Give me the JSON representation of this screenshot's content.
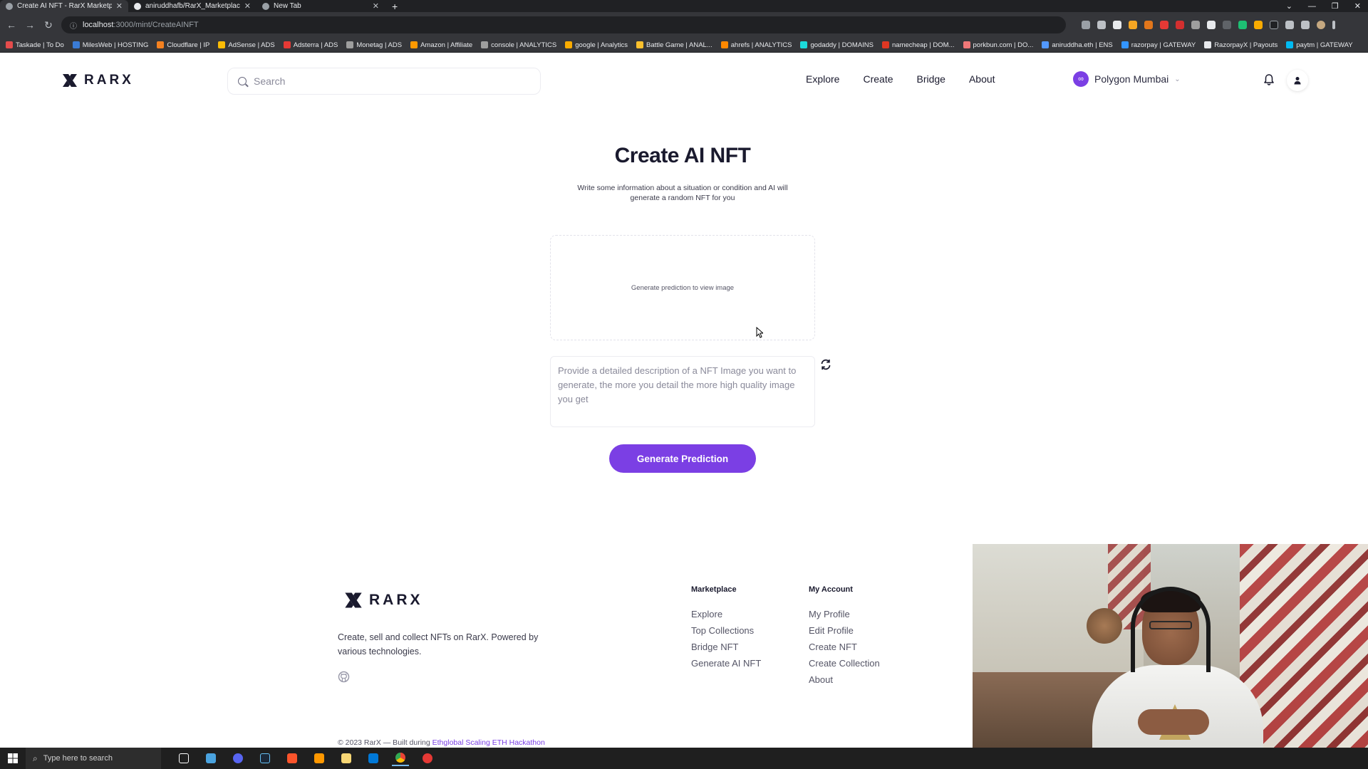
{
  "browser": {
    "tabs": [
      {
        "title": "Create AI NFT - RarX Marketplace",
        "active": true
      },
      {
        "title": "aniruddhafb/RarX_Marketplace:",
        "active": false
      },
      {
        "title": "New Tab",
        "active": false
      }
    ],
    "new_tab": "+",
    "url_host": "localhost",
    "url_path": ":3000/mint/CreateAINFT",
    "bookmarks": [
      {
        "label": "Taskade | To Do",
        "color": "#e44c4c"
      },
      {
        "label": "MilesWeb | HOSTING",
        "color": "#3a7bd5"
      },
      {
        "label": "Cloudflare | IP",
        "color": "#f48120"
      },
      {
        "label": "AdSense | ADS",
        "color": "#fbbc05"
      },
      {
        "label": "Adsterra | ADS",
        "color": "#e53935"
      },
      {
        "label": "Monetag | ADS",
        "color": "#9e9e9e"
      },
      {
        "label": "Amazon | Affiliate",
        "color": "#ff9900"
      },
      {
        "label": "console | ANALYTICS",
        "color": "#9e9e9e"
      },
      {
        "label": "google | Analytics",
        "color": "#f9ab00"
      },
      {
        "label": "Battle Game | ANAL...",
        "color": "#fbc02d"
      },
      {
        "label": "ahrefs | ANALYTICS",
        "color": "#ff8800"
      },
      {
        "label": "godaddy | DOMAINS",
        "color": "#1bdbdb"
      },
      {
        "label": "namecheap | DOM...",
        "color": "#de3723"
      },
      {
        "label": "porkbun.com | DO...",
        "color": "#ef7878"
      },
      {
        "label": "aniruddha.eth | ENS",
        "color": "#5298ff"
      },
      {
        "label": "razorpay | GATEWAY",
        "color": "#3395ff"
      },
      {
        "label": "RazorpayX | Payouts",
        "color": "#e8eaed"
      },
      {
        "label": "paytm | GATEWAY",
        "color": "#00baf2"
      }
    ]
  },
  "header": {
    "logo": "RARX",
    "search_placeholder": "Search",
    "nav": [
      "Explore",
      "Create",
      "Bridge",
      "About"
    ],
    "network": "Polygon Mumbai"
  },
  "main": {
    "title": "Create AI NFT",
    "subtitle": "Write some information about a situation or condition and AI will generate a random NFT for you",
    "preview_text": "Generate prediction to view image",
    "prompt_placeholder": "Provide a detailed description of a NFT Image you want to generate, the more you detail the more high quality image you get",
    "generate_button": "Generate Prediction"
  },
  "footer": {
    "logo": "RARX",
    "tagline": "Create, sell and collect NFTs on RarX. Powered by various technologies.",
    "marketplace": {
      "title": "Marketplace",
      "links": [
        "Explore",
        "Top Collections",
        "Bridge NFT",
        "Generate AI NFT"
      ]
    },
    "account": {
      "title": "My Account",
      "links": [
        "My Profile",
        "Edit Profile",
        "Create NFT",
        "Create Collection",
        "About"
      ]
    },
    "copyright_prefix": "© 2023 RarX — Built during",
    "copyright_link": "Ethglobal Scaling ETH Hackathon"
  },
  "taskbar": {
    "search_text": "Type here to search"
  },
  "colors": {
    "accent": "#7b3fe4",
    "text": "#1a1a2e"
  }
}
